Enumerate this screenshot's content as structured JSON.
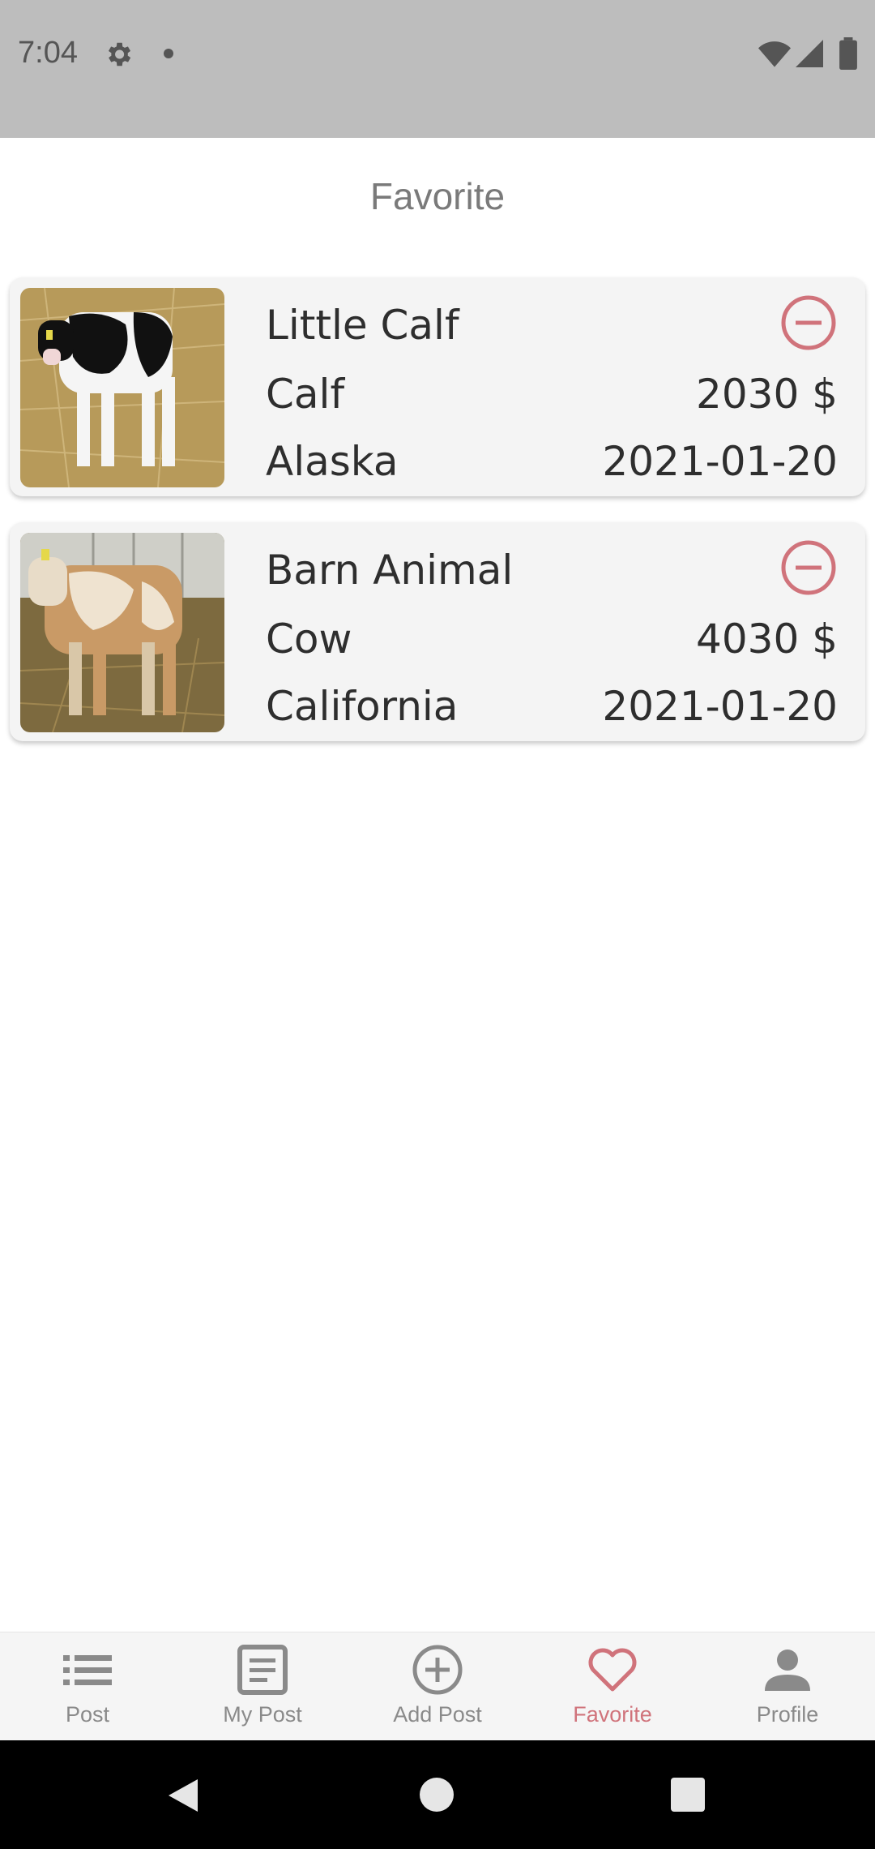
{
  "status_bar": {
    "time": "7:04",
    "icons": [
      "gear-icon",
      "dot-icon",
      "wifi-icon",
      "signal-icon",
      "battery-icon"
    ]
  },
  "header": {
    "title": "Favorite"
  },
  "favorites": [
    {
      "title": "Little Calf",
      "type": "Calf",
      "price": "2030 $",
      "location": "Alaska",
      "date": "2021-01-20",
      "image": "black-white-calf-photo",
      "action_icon": "remove-circle-icon"
    },
    {
      "title": "Barn Animal",
      "type": "Cow",
      "price": "4030 $",
      "location": "California",
      "date": "2021-01-20",
      "image": "brown-white-calf-photo",
      "action_icon": "remove-circle-icon"
    }
  ],
  "bottom_nav": {
    "items": [
      {
        "label": "Post",
        "icon": "list-icon"
      },
      {
        "label": "My Post",
        "icon": "document-icon"
      },
      {
        "label": "Add Post",
        "icon": "add-circle-icon"
      },
      {
        "label": "Favorite",
        "icon": "heart-icon"
      },
      {
        "label": "Profile",
        "icon": "person-icon"
      }
    ],
    "active": "Favorite"
  },
  "colors": {
    "accent": "#d0737b",
    "status_bar": "#bdbdbd",
    "card_bg": "#f4f4f4",
    "nav_inactive": "#8a8a8a"
  }
}
